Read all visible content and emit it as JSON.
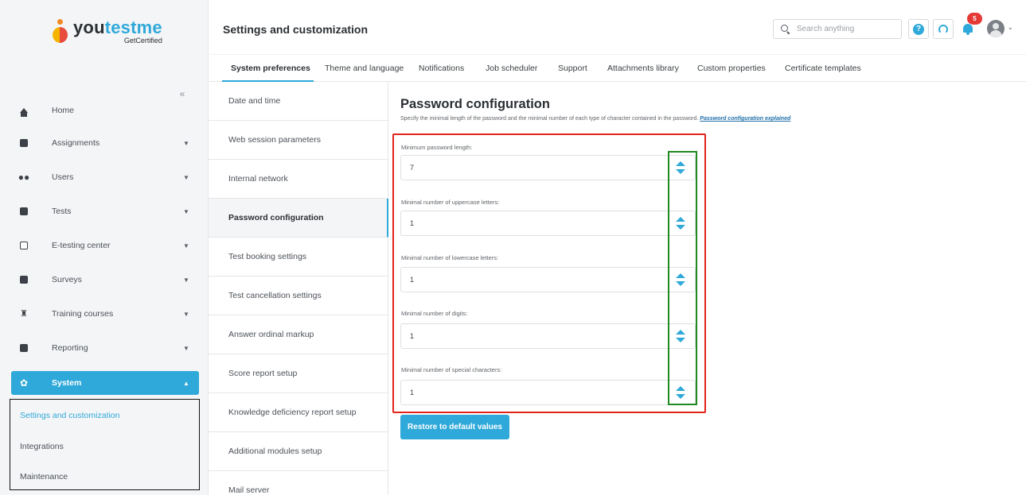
{
  "brand": {
    "name_part1": "you",
    "name_part2": "testme",
    "tagline": "GetCertified"
  },
  "colors": {
    "accent": "#2fa9d9",
    "annotation_red": "#e2231a",
    "annotation_green": "#1f8a1f",
    "badge": "#e53935"
  },
  "sidebar": {
    "collapse_glyph": "«",
    "items": [
      {
        "label": "Home",
        "icon": "home-icon",
        "has_chevron": false
      },
      {
        "label": "Assignments",
        "icon": "assignments-icon",
        "chevron": "▼"
      },
      {
        "label": "Users",
        "icon": "users-icon",
        "chevron": "▼"
      },
      {
        "label": "Tests",
        "icon": "tests-icon",
        "chevron": "▼"
      },
      {
        "label": "E-testing center",
        "icon": "e-testing-icon",
        "chevron": "▼"
      },
      {
        "label": "Surveys",
        "icon": "surveys-icon",
        "chevron": "▼"
      },
      {
        "label": "Training courses",
        "icon": "trophy-icon",
        "chevron": "▼"
      },
      {
        "label": "Reporting",
        "icon": "reporting-icon",
        "chevron": "▼"
      }
    ],
    "active_section": {
      "label": "System",
      "icon": "gear-icon",
      "chevron": "▲"
    },
    "sub_items": [
      "Settings and customization",
      "Integrations",
      "Maintenance"
    ]
  },
  "header": {
    "title": "Settings and customization",
    "search_placeholder": "Search anything",
    "help_glyph": "?",
    "notification_count": "5",
    "avatar_caret": "⌄"
  },
  "tabs": [
    "System preferences",
    "Theme and language",
    "Notifications",
    "Job scheduler",
    "Support",
    "Attachments library",
    "Custom properties",
    "Certificate templates"
  ],
  "settings_list": [
    "Date and time",
    "Web session parameters",
    "Internal network",
    "Password configuration",
    "Test booking settings",
    "Test cancellation settings",
    "Answer ordinal markup",
    "Score report setup",
    "Knowledge deficiency report setup",
    "Additional modules setup",
    "Mail server"
  ],
  "main": {
    "title": "Password configuration",
    "description": "Specify the minimal length of the password and the minimal number of each type of character contained in the password.",
    "description_link": "Password configuration explained",
    "fields": [
      {
        "label": "Minimum password length:",
        "value": "7"
      },
      {
        "label": "Minimal number of uppercase letters:",
        "value": "1"
      },
      {
        "label": "Minimal number of lowercase letters:",
        "value": "1"
      },
      {
        "label": "Minimal number of digits:",
        "value": "1"
      },
      {
        "label": "Minimal number of special characters:",
        "value": "1"
      }
    ],
    "restore_button": "Restore to default values"
  }
}
